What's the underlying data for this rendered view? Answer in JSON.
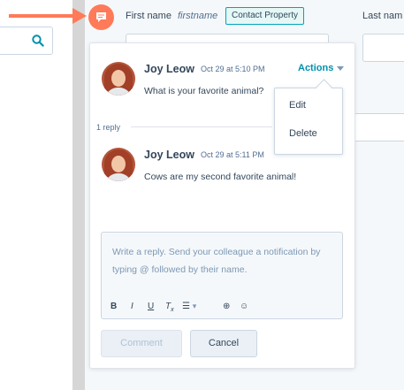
{
  "property_header": {
    "first_name_label": "First name",
    "first_name_internal": "firstname",
    "contact_property_tag": "Contact Property",
    "last_name_label": "Last nam"
  },
  "comment": {
    "author": "Joy Leow",
    "timestamp": "Oct 29 at 5:10 PM",
    "text": "What is your favorite animal?",
    "actions_label": "Actions"
  },
  "actions_menu": [
    "Edit",
    "Delete"
  ],
  "reply_count": "1 reply",
  "reply": {
    "author": "Joy Leow",
    "timestamp": "Oct 29 at 5:11 PM",
    "text": "Cows are my second favorite animal!"
  },
  "reply_box": {
    "placeholder": "Write a reply. Send your colleague a notification by typing @ followed by their name.",
    "toolbar": {
      "bold": "B",
      "italic": "I",
      "underline": "U",
      "clear_format": "T",
      "clear_format_sub": "x",
      "list": "☰",
      "list_caret": "▾",
      "attachment": "⊕",
      "emoji": "☺"
    }
  },
  "buttons": {
    "comment": "Comment",
    "cancel": "Cancel"
  },
  "colors": {
    "accent_orange": "#ff7a59",
    "link_teal": "#0091ae",
    "tag_border": "#00a4bd",
    "text_dark": "#33475b"
  },
  "icons": {
    "search": "search-icon",
    "comment": "comment-bubble-icon",
    "arrow": "arrow-right-icon"
  }
}
